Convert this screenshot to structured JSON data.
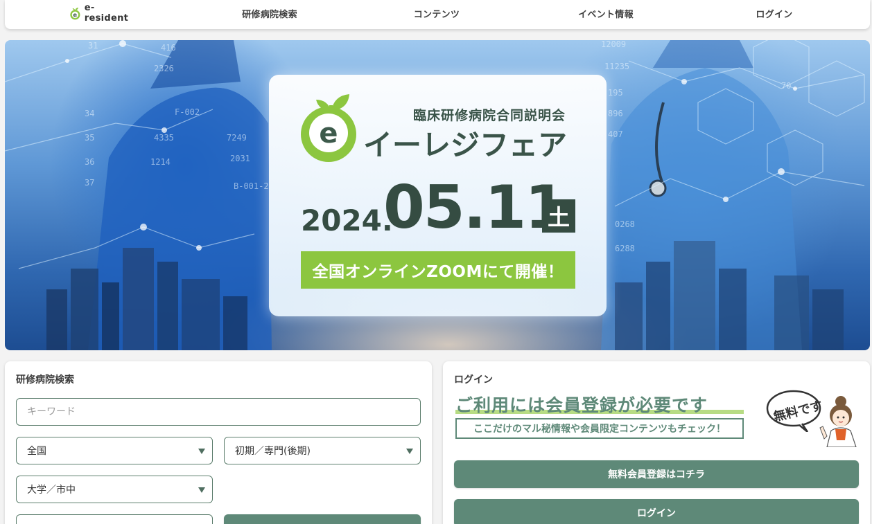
{
  "nav": {
    "logo_text": "e-resident",
    "items": [
      "研修病院検索",
      "コンテンツ",
      "イベント情報",
      "ログイン"
    ]
  },
  "hero": {
    "subtitle": "臨床研修病院合同説明会",
    "title": "イーレジフェア",
    "year": "2024.",
    "month_day": "05.11",
    "day_of_week": "土",
    "banner": "全国オンラインZOOMにて開催！",
    "logo_letter": "e"
  },
  "search": {
    "title": "研修病院検索",
    "keyword_placeholder": "キーワード",
    "region": "全国",
    "period": "初期／専門(後期)",
    "type": "大学／市中"
  },
  "login": {
    "title": "ログイン",
    "promo_title": "ご利用には会員登録が必要です",
    "promo_sub": "ここだけのマル秘情報や会員限定コンテンツもチェック！",
    "free_label": "無料です",
    "register_button": "無料会員登録はコチラ",
    "login_button": "ログイン"
  },
  "colors": {
    "brand_green": "#8cc63f",
    "button_green": "#5e8978",
    "dark_text": "#354c42"
  },
  "icons": [
    "e-resident-logo-icon",
    "chevron-down-icon",
    "sprout-logo-icon",
    "mascot-icon"
  ]
}
